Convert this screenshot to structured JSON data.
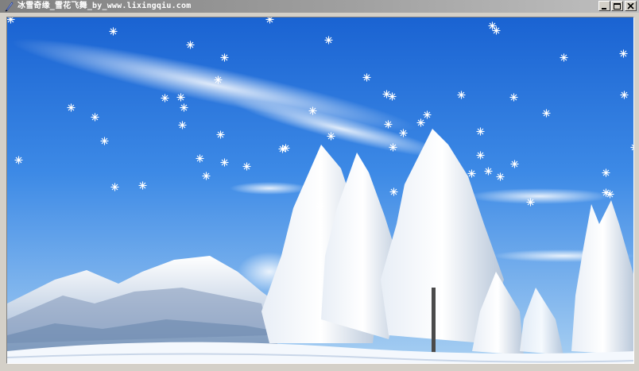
{
  "window": {
    "title": "冰雪奇缘_雪花飞舞_by_www.lixingqiu.com",
    "icon": "feather-pen-icon",
    "controls": {
      "minimize": "minimize-icon",
      "maximize": "maximize-icon",
      "close": "close-icon"
    }
  },
  "scene": {
    "description_icon": "snowy-forest-image",
    "colors": {
      "sky_top": "#1e6fd9",
      "sky_bottom": "#8fc2ef",
      "snow": "#f4f8fd",
      "flake": "#ffffff"
    }
  }
}
